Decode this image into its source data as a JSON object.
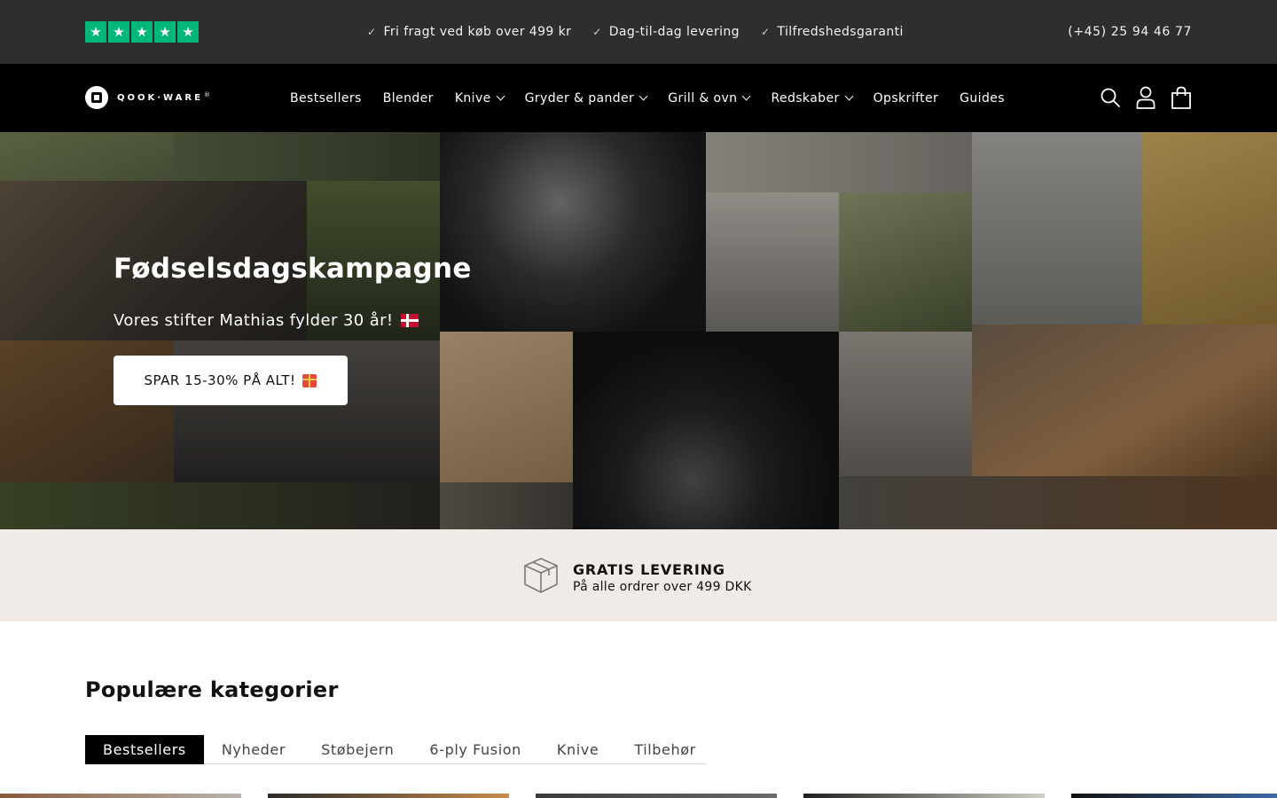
{
  "topbar": {
    "rating_stars": 5,
    "star_glyph": "★",
    "usps": [
      {
        "icon": "check-icon",
        "glyph": "✓",
        "label": "Fri fragt ved køb over 499 kr"
      },
      {
        "icon": "check-icon",
        "glyph": "✓",
        "label": "Dag-til-dag levering"
      },
      {
        "icon": "check-icon",
        "glyph": "✓",
        "label": "Tilfredshedsgaranti"
      }
    ],
    "phone": "(+45) 25 94 46 77"
  },
  "header": {
    "logo_text": "QOOK·WARE",
    "logo_trademark": "®",
    "nav": [
      {
        "label": "Bestsellers",
        "dropdown": false
      },
      {
        "label": "Blender",
        "dropdown": false
      },
      {
        "label": "Knive",
        "dropdown": true
      },
      {
        "label": "Gryder & pander",
        "dropdown": true
      },
      {
        "label": "Grill & ovn",
        "dropdown": true
      },
      {
        "label": "Redskaber",
        "dropdown": true
      },
      {
        "label": "Opskrifter",
        "dropdown": false
      },
      {
        "label": "Guides",
        "dropdown": false
      }
    ],
    "icons": [
      "search-icon",
      "account-icon",
      "cart-icon"
    ]
  },
  "hero": {
    "title": "Fødselsdagskampagne",
    "subtitle": "Vores stifter Mathias fylder 30 år!",
    "subtitle_icon": "danish-flag-icon",
    "button_label": "SPAR 15-30% PÅ ALT!",
    "button_icon": "gift-icon"
  },
  "shipping": {
    "icon": "package-icon",
    "title": "GRATIS LEVERING",
    "subtitle": "På alle ordrer over 499 DKK"
  },
  "categories": {
    "title": "Populære kategorier",
    "tabs": [
      {
        "label": "Bestsellers",
        "active": true
      },
      {
        "label": "Nyheder",
        "active": false
      },
      {
        "label": "Støbejern",
        "active": false
      },
      {
        "label": "6-ply Fusion",
        "active": false
      },
      {
        "label": "Knive",
        "active": false
      },
      {
        "label": "Tilbehør",
        "active": false
      }
    ]
  },
  "colors": {
    "topbar_bg": "#2e2e2e",
    "header_bg": "#000000",
    "trustpilot_green": "#00b67a",
    "shipping_bg": "#f0ebe7",
    "tab_active_bg": "#000000"
  }
}
